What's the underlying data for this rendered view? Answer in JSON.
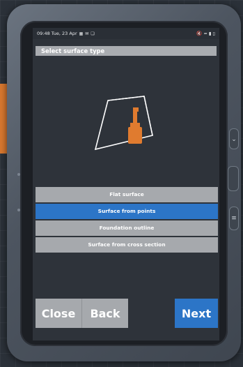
{
  "status_bar": {
    "time_date": "09:48  Tue, 23 Apr",
    "left_icons": [
      "image-icon",
      "mail-icon",
      "copy-icon"
    ],
    "right_icons": [
      "mute-icon",
      "wifi-icon",
      "signal-icon",
      "battery-icon"
    ]
  },
  "header": {
    "title": "Select surface type"
  },
  "surface_options": [
    {
      "label": "Flat surface",
      "selected": false
    },
    {
      "label": "Surface from points",
      "selected": true
    },
    {
      "label": "Foundation outline",
      "selected": false
    },
    {
      "label": "Surface from cross section",
      "selected": false
    }
  ],
  "footer": {
    "close_label": "Close",
    "back_label": "Back",
    "next_label": "Next"
  },
  "colors": {
    "accent_blue": "#2c75c7",
    "button_gray": "#a6a9ad",
    "excavator_orange": "#e07b2f",
    "screen_bg": "#2e333a"
  },
  "side_buttons": [
    "chevron-down-icon",
    "oval-button-icon",
    "menu-icon"
  ]
}
